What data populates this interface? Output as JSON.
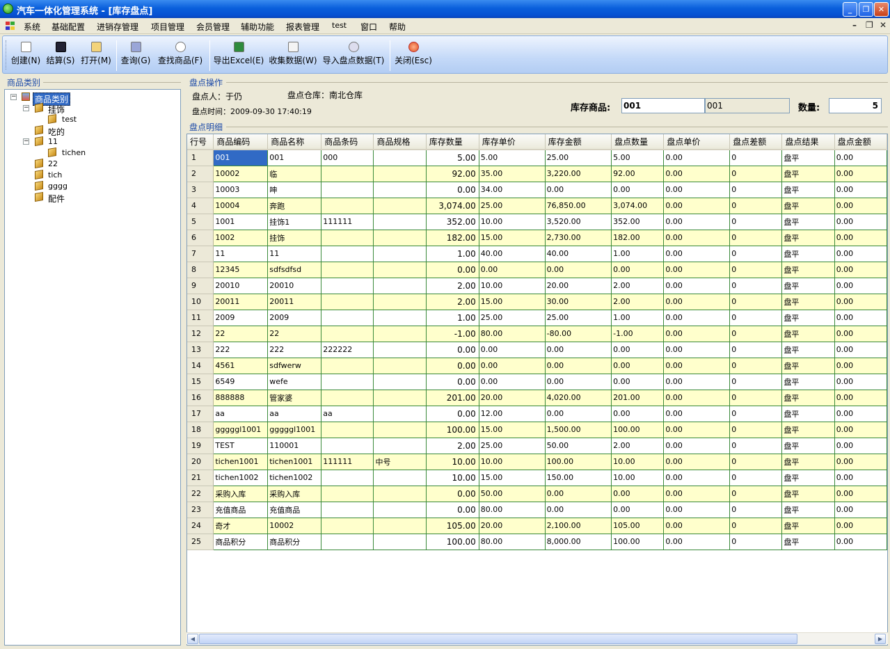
{
  "window": {
    "title": "汽车一体化管理系统 - [库存盘点]"
  },
  "menu": [
    "系统",
    "基础配置",
    "进销存管理",
    "项目管理",
    "会员管理",
    "辅助功能",
    "报表管理",
    "test",
    "窗口",
    "帮助"
  ],
  "toolbar": {
    "create": "创建(N)",
    "settle": "结算(S)",
    "open": "打开(M)",
    "query": "查询(G)",
    "find": "查找商品(F)",
    "export": "导出Excel(E)",
    "collect": "收集数据(W)",
    "import": "导入盘点数据(T)",
    "close": "关闭(Esc)"
  },
  "left": {
    "group": "商品类别",
    "tree": {
      "root": "商品类别",
      "n1": "挂饰",
      "n1a": "test",
      "n2": "吃的",
      "n3": "11",
      "n3a": "tichen",
      "n4": "22",
      "n5": "tich",
      "n6": "gggg",
      "n7": "配件"
    }
  },
  "op": {
    "group": "盘点操作",
    "person": "盘点人：于仍",
    "warehouse": "盘点仓库：南北仓库",
    "time": "盘点时间：2009-09-30 17:40:19",
    "stock_label": "库存商品:",
    "stock_value": "001",
    "stock_value2": "001",
    "qty_label": "数量:",
    "qty_value": "5"
  },
  "detail": {
    "group": "盘点明细",
    "columns": [
      "行号",
      "商品编码",
      "商品名称",
      "商品条码",
      "商品规格",
      "库存数量",
      "库存单价",
      "库存金额",
      "盘点数量",
      "盘点单价",
      "盘点差额",
      "盘点结果",
      "盘点金额"
    ],
    "rows": [
      [
        "1",
        "001",
        "001",
        "000",
        "",
        "5.00",
        "5.00",
        "25.00",
        "5.00",
        "0.00",
        "0",
        "盘平",
        "0.00"
      ],
      [
        "2",
        "10002",
        "临",
        "",
        "",
        "92.00",
        "35.00",
        "3,220.00",
        "92.00",
        "0.00",
        "0",
        "盘平",
        "0.00"
      ],
      [
        "3",
        "10003",
        "呻",
        "",
        "",
        "0.00",
        "34.00",
        "0.00",
        "0.00",
        "0.00",
        "0",
        "盘平",
        "0.00"
      ],
      [
        "4",
        "10004",
        "奔跑",
        "",
        "",
        "3,074.00",
        "25.00",
        "76,850.00",
        "3,074.00",
        "0.00",
        "0",
        "盘平",
        "0.00"
      ],
      [
        "5",
        "1001",
        "挂饰1",
        "111111",
        "",
        "352.00",
        "10.00",
        "3,520.00",
        "352.00",
        "0.00",
        "0",
        "盘平",
        "0.00"
      ],
      [
        "6",
        "1002",
        "挂饰",
        "",
        "",
        "182.00",
        "15.00",
        "2,730.00",
        "182.00",
        "0.00",
        "0",
        "盘平",
        "0.00"
      ],
      [
        "7",
        "11",
        "11",
        "",
        "",
        "1.00",
        "40.00",
        "40.00",
        "1.00",
        "0.00",
        "0",
        "盘平",
        "0.00"
      ],
      [
        "8",
        "12345",
        "sdfsdfsd",
        "",
        "",
        "0.00",
        "0.00",
        "0.00",
        "0.00",
        "0.00",
        "0",
        "盘平",
        "0.00"
      ],
      [
        "9",
        "20010",
        "20010",
        "",
        "",
        "2.00",
        "10.00",
        "20.00",
        "2.00",
        "0.00",
        "0",
        "盘平",
        "0.00"
      ],
      [
        "10",
        "20011",
        "20011",
        "",
        "",
        "2.00",
        "15.00",
        "30.00",
        "2.00",
        "0.00",
        "0",
        "盘平",
        "0.00"
      ],
      [
        "11",
        "2009",
        "2009",
        "",
        "",
        "1.00",
        "25.00",
        "25.00",
        "1.00",
        "0.00",
        "0",
        "盘平",
        "0.00"
      ],
      [
        "12",
        "22",
        "22",
        "",
        "",
        "-1.00",
        "80.00",
        "-80.00",
        "-1.00",
        "0.00",
        "0",
        "盘平",
        "0.00"
      ],
      [
        "13",
        "222",
        "222",
        "222222",
        "",
        "0.00",
        "0.00",
        "0.00",
        "0.00",
        "0.00",
        "0",
        "盘平",
        "0.00"
      ],
      [
        "14",
        "4561",
        "sdfwerw",
        "",
        "",
        "0.00",
        "0.00",
        "0.00",
        "0.00",
        "0.00",
        "0",
        "盘平",
        "0.00"
      ],
      [
        "15",
        "6549",
        "wefe",
        "",
        "",
        "0.00",
        "0.00",
        "0.00",
        "0.00",
        "0.00",
        "0",
        "盘平",
        "0.00"
      ],
      [
        "16",
        "888888",
        "管家婆",
        "",
        "",
        "201.00",
        "20.00",
        "4,020.00",
        "201.00",
        "0.00",
        "0",
        "盘平",
        "0.00"
      ],
      [
        "17",
        "aa",
        "aa",
        "aa",
        "",
        "0.00",
        "12.00",
        "0.00",
        "0.00",
        "0.00",
        "0",
        "盘平",
        "0.00"
      ],
      [
        "18",
        "gggggl1001",
        "gggggl1001",
        "",
        "",
        "100.00",
        "15.00",
        "1,500.00",
        "100.00",
        "0.00",
        "0",
        "盘平",
        "0.00"
      ],
      [
        "19",
        "TEST",
        "110001",
        "",
        "",
        "2.00",
        "25.00",
        "50.00",
        "2.00",
        "0.00",
        "0",
        "盘平",
        "0.00"
      ],
      [
        "20",
        "tichen1001",
        "tichen1001",
        "111111",
        "中号",
        "10.00",
        "10.00",
        "100.00",
        "10.00",
        "0.00",
        "0",
        "盘平",
        "0.00"
      ],
      [
        "21",
        "tichen1002",
        "tichen1002",
        "",
        "",
        "10.00",
        "15.00",
        "150.00",
        "10.00",
        "0.00",
        "0",
        "盘平",
        "0.00"
      ],
      [
        "22",
        "采购入库",
        "采购入库",
        "",
        "",
        "0.00",
        "50.00",
        "0.00",
        "0.00",
        "0.00",
        "0",
        "盘平",
        "0.00"
      ],
      [
        "23",
        "充值商品",
        "充值商品",
        "",
        "",
        "0.00",
        "80.00",
        "0.00",
        "0.00",
        "0.00",
        "0",
        "盘平",
        "0.00"
      ],
      [
        "24",
        "奇才",
        "10002",
        "",
        "",
        "105.00",
        "20.00",
        "2,100.00",
        "105.00",
        "0.00",
        "0",
        "盘平",
        "0.00"
      ],
      [
        "25",
        "商品积分",
        "商品积分",
        "",
        "",
        "100.00",
        "80.00",
        "8,000.00",
        "100.00",
        "0.00",
        "0",
        "盘平",
        "0.00"
      ]
    ]
  }
}
